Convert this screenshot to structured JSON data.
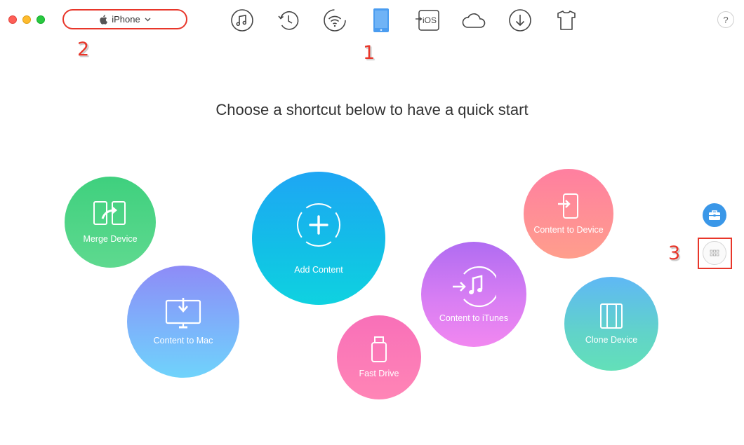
{
  "window": {
    "traffic_lights": [
      "close",
      "minimize",
      "maximize"
    ]
  },
  "device_selector": {
    "icon": "apple-icon",
    "label": "iPhone",
    "chevron": "chevron-down-icon"
  },
  "toolbar": {
    "items": [
      {
        "name": "music-icon",
        "active": false
      },
      {
        "name": "history-icon",
        "active": false
      },
      {
        "name": "wifi-icon",
        "active": false
      },
      {
        "name": "iphone-icon",
        "active": true
      },
      {
        "name": "ios-icon",
        "label": "iOS",
        "active": false
      },
      {
        "name": "cloud-icon",
        "active": false
      },
      {
        "name": "download-icon",
        "active": false
      },
      {
        "name": "tshirt-icon",
        "active": false
      }
    ],
    "active_color": "#3a97e8",
    "icon_color": "#444444"
  },
  "help": {
    "label": "?"
  },
  "callouts": {
    "one": "1",
    "two": "2",
    "three": "3",
    "color": "#e8362a"
  },
  "headline": "Choose a shortcut below to have a quick start",
  "shortcuts": {
    "merge_device": {
      "label": "Merge Device",
      "icon": "merge-icon"
    },
    "content_to_mac": {
      "label": "Content to Mac",
      "icon": "monitor-download-icon"
    },
    "add_content": {
      "label": "Add Content",
      "icon": "plus-circle-icon"
    },
    "fast_drive": {
      "label": "Fast Drive",
      "icon": "usb-drive-icon"
    },
    "content_to_itunes": {
      "label": "Content to iTunes",
      "icon": "itunes-icon"
    },
    "content_to_device": {
      "label": "Content to Device",
      "icon": "phone-import-icon"
    },
    "clone_device": {
      "label": "Clone Device",
      "icon": "clone-phone-icon"
    }
  },
  "side_buttons": [
    {
      "name": "toolkit-icon",
      "color": "#3a97e8"
    },
    {
      "name": "grid-more-icon"
    }
  ]
}
